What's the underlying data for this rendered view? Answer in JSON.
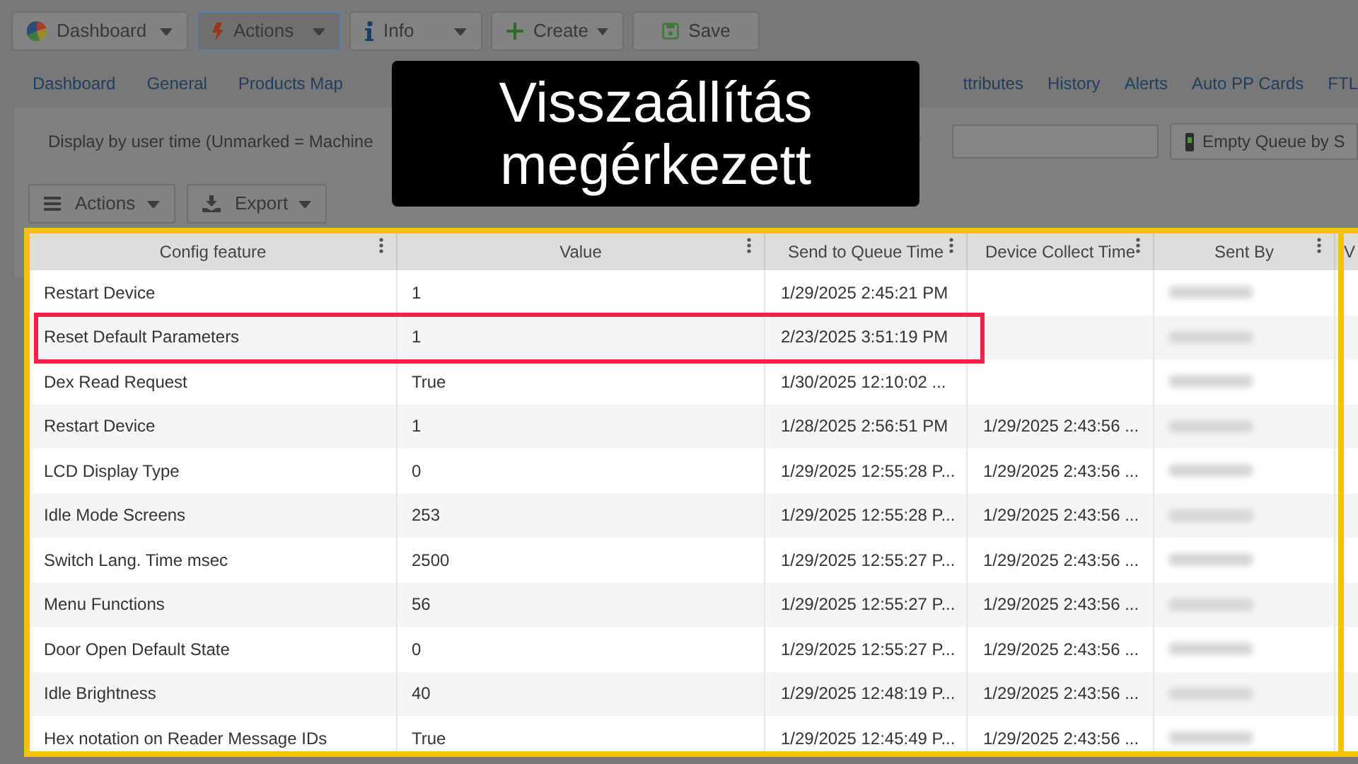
{
  "toolbar": [
    {
      "label": "Dashboard",
      "dropdown": true,
      "selected": false
    },
    {
      "label": "Actions",
      "dropdown": true,
      "selected": true
    },
    {
      "label": "Info",
      "dropdown": true,
      "selected": false
    },
    {
      "label": "Create",
      "dropdown": true,
      "selected": false
    },
    {
      "label": "Save",
      "dropdown": false,
      "selected": false
    }
  ],
  "tabs": {
    "left": [
      "Dashboard",
      "General",
      "Products Map"
    ],
    "right": [
      "ttributes",
      "History",
      "Alerts",
      "Auto PP Cards",
      "FTL"
    ]
  },
  "filter": {
    "label": "Display by user time (Unmarked = Machine",
    "empty_queue_button": "Empty Queue by S"
  },
  "grid_buttons": [
    {
      "label": "Actions"
    },
    {
      "label": "Export"
    }
  ],
  "table": {
    "columns": [
      "Config feature",
      "Value",
      "Send to Queue Time",
      "Device Collect Time",
      "Sent By",
      "V"
    ],
    "rows": [
      {
        "feature": "Restart Device",
        "value": "1",
        "send_time": "1/29/2025 2:45:21 PM",
        "collect_time": "",
        "highlighted": false
      },
      {
        "feature": "Reset Default Parameters",
        "value": "1",
        "send_time": "2/23/2025 3:51:19 PM",
        "collect_time": "",
        "highlighted": true
      },
      {
        "feature": "Dex Read Request",
        "value": "True",
        "send_time": "1/30/2025 12:10:02 ...",
        "collect_time": "",
        "highlighted": false
      },
      {
        "feature": "Restart Device",
        "value": "1",
        "send_time": "1/28/2025 2:56:51 PM",
        "collect_time": "1/29/2025 2:43:56 ...",
        "highlighted": false
      },
      {
        "feature": "LCD Display Type",
        "value": "0",
        "send_time": "1/29/2025 12:55:28 P...",
        "collect_time": "1/29/2025 2:43:56 ...",
        "highlighted": false
      },
      {
        "feature": "Idle Mode Screens",
        "value": "253",
        "send_time": "1/29/2025 12:55:28 P...",
        "collect_time": "1/29/2025 2:43:56 ...",
        "highlighted": false
      },
      {
        "feature": "Switch Lang. Time msec",
        "value": "2500",
        "send_time": "1/29/2025 12:55:27 P...",
        "collect_time": "1/29/2025 2:43:56 ...",
        "highlighted": false
      },
      {
        "feature": "Menu Functions",
        "value": "56",
        "send_time": "1/29/2025 12:55:27 P...",
        "collect_time": "1/29/2025 2:43:56 ...",
        "highlighted": false
      },
      {
        "feature": "Door Open Default State",
        "value": "0",
        "send_time": "1/29/2025 12:55:27 P...",
        "collect_time": "1/29/2025 2:43:56 ...",
        "highlighted": false
      },
      {
        "feature": "Idle Brightness",
        "value": "40",
        "send_time": "1/29/2025 12:48:19 P...",
        "collect_time": "1/29/2025 2:43:56 ...",
        "highlighted": false
      },
      {
        "feature": "Hex notation on Reader Message IDs",
        "value": "True",
        "send_time": "1/29/2025 12:45:49 P...",
        "collect_time": "1/29/2025 2:43:56 ...",
        "highlighted": false
      }
    ]
  },
  "callout": {
    "lines": [
      "Visszaállítás",
      "megérkezett"
    ]
  }
}
